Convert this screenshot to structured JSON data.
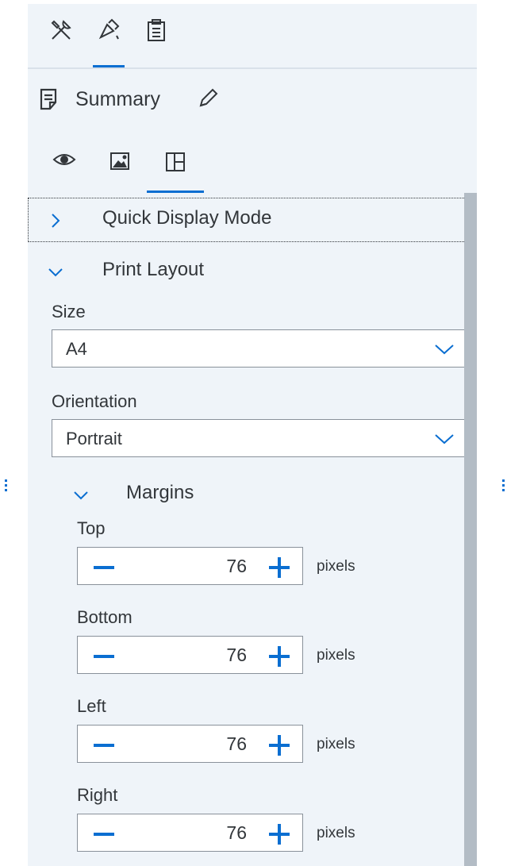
{
  "toolbar": {
    "tools": [
      {
        "icon": "tools-icon"
      },
      {
        "icon": "paintbrush-icon",
        "selected": true
      },
      {
        "icon": "clipboard-icon"
      }
    ]
  },
  "summary": {
    "icon": "document-icon",
    "label": "Summary",
    "edit_icon": "pencil-icon"
  },
  "view_tabs": [
    {
      "icon": "eye-icon"
    },
    {
      "icon": "image-icon"
    },
    {
      "icon": "layout-icon",
      "selected": true
    }
  ],
  "quick_display": {
    "label": "Quick Display Mode",
    "expanded": false
  },
  "print_layout": {
    "label": "Print Layout",
    "expanded": true,
    "size": {
      "label": "Size",
      "value": "A4"
    },
    "orientation": {
      "label": "Orientation",
      "value": "Portrait"
    },
    "margins": {
      "label": "Margins",
      "expanded": true,
      "items": [
        {
          "label": "Top",
          "value": "76",
          "unit": "pixels"
        },
        {
          "label": "Bottom",
          "value": "76",
          "unit": "pixels"
        },
        {
          "label": "Left",
          "value": "76",
          "unit": "pixels"
        },
        {
          "label": "Right",
          "value": "76",
          "unit": "pixels"
        }
      ]
    }
  },
  "colors": {
    "accent": "#0a6ed1",
    "panel": "#eff4f9",
    "text": "#32363a"
  }
}
